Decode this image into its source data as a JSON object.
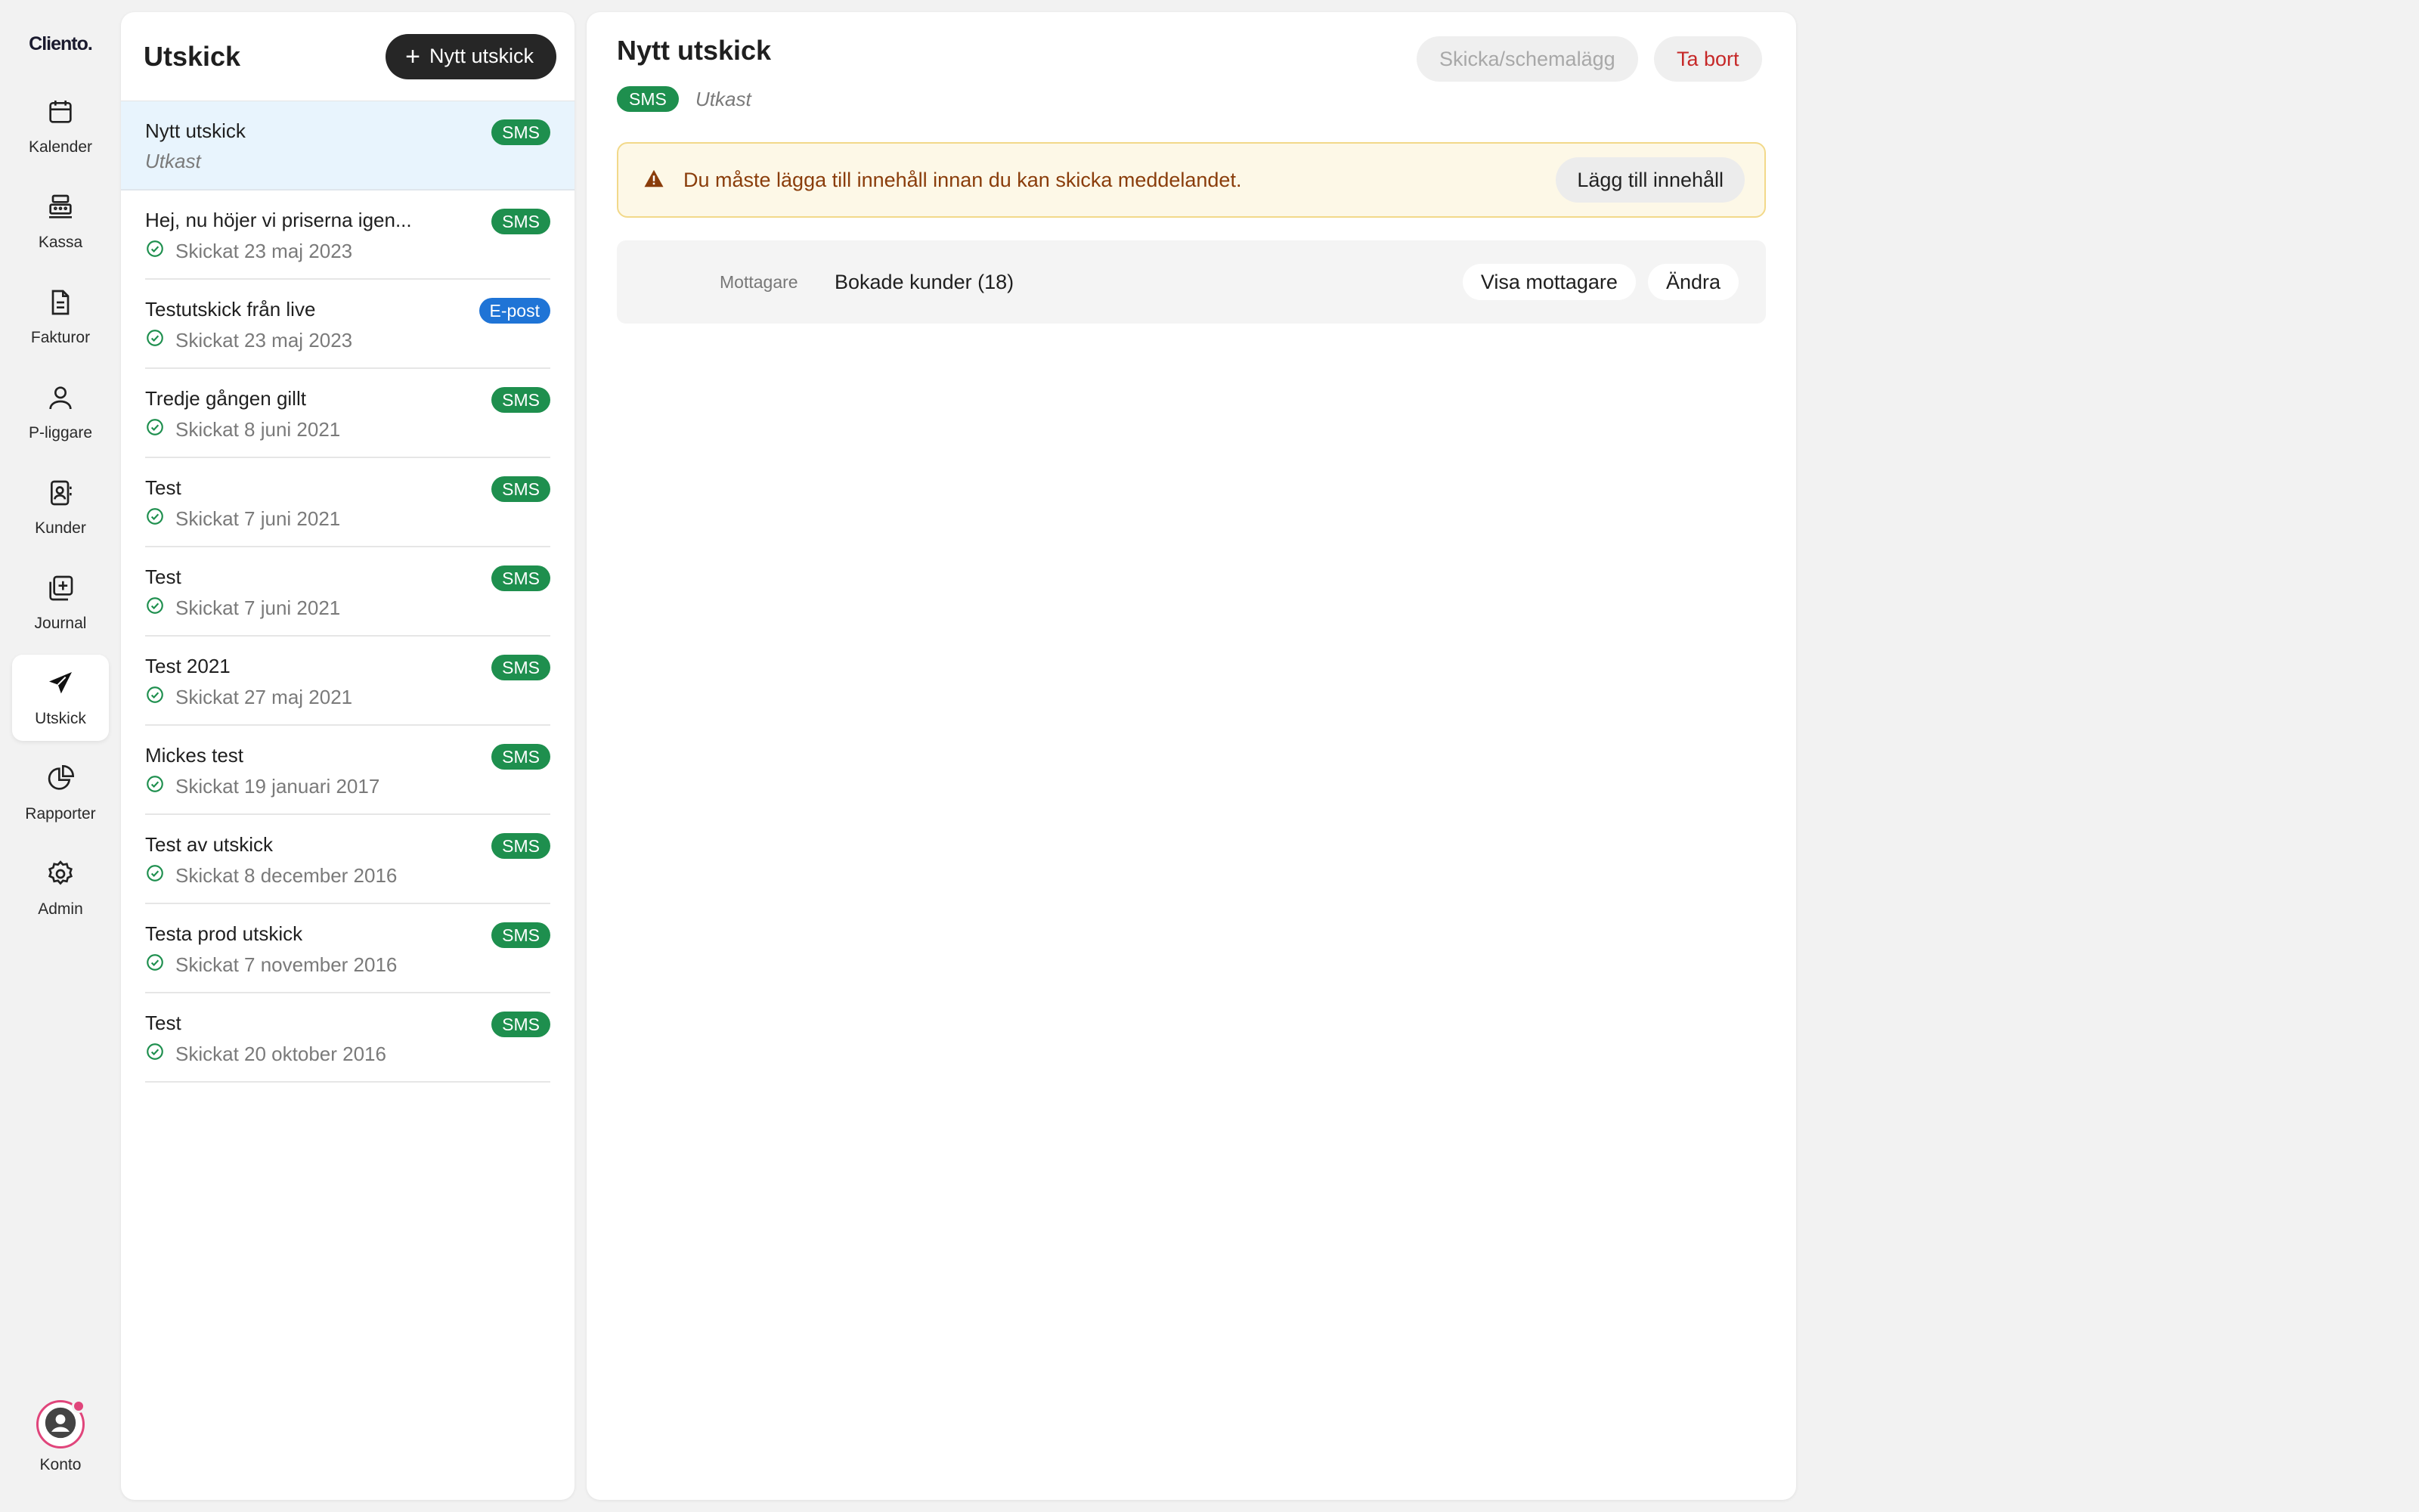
{
  "sidebar": {
    "logo": "Cliento.",
    "items": [
      {
        "label": "Kalender",
        "icon": "calendar-icon"
      },
      {
        "label": "Kassa",
        "icon": "cash-register-icon"
      },
      {
        "label": "Fakturor",
        "icon": "document-icon"
      },
      {
        "label": "P-liggare",
        "icon": "person-icon"
      },
      {
        "label": "Kunder",
        "icon": "contacts-icon"
      },
      {
        "label": "Journal",
        "icon": "journal-icon"
      },
      {
        "label": "Utskick",
        "icon": "send-icon",
        "active": true
      },
      {
        "label": "Rapporter",
        "icon": "pie-chart-icon"
      },
      {
        "label": "Admin",
        "icon": "gear-icon"
      }
    ],
    "account_label": "Konto"
  },
  "list": {
    "title": "Utskick",
    "new_button": "Nytt utskick",
    "rows": [
      {
        "title": "Nytt utskick",
        "sub": "Utkast",
        "badge": "SMS",
        "badge_type": "sms",
        "selected": true,
        "sent": false
      },
      {
        "title": "Hej, nu höjer vi priserna igen...",
        "sub": "Skickat 23 maj 2023",
        "badge": "SMS",
        "badge_type": "sms",
        "sent": true
      },
      {
        "title": "Testutskick från live",
        "sub": "Skickat 23 maj 2023",
        "badge": "E-post",
        "badge_type": "email",
        "sent": true
      },
      {
        "title": "Tredje gången gillt",
        "sub": "Skickat 8 juni 2021",
        "badge": "SMS",
        "badge_type": "sms",
        "sent": true
      },
      {
        "title": "Test",
        "sub": "Skickat 7 juni 2021",
        "badge": "SMS",
        "badge_type": "sms",
        "sent": true
      },
      {
        "title": "Test",
        "sub": "Skickat 7 juni 2021",
        "badge": "SMS",
        "badge_type": "sms",
        "sent": true
      },
      {
        "title": "Test 2021",
        "sub": "Skickat 27 maj 2021",
        "badge": "SMS",
        "badge_type": "sms",
        "sent": true
      },
      {
        "title": "Mickes test",
        "sub": "Skickat 19 januari 2017",
        "badge": "SMS",
        "badge_type": "sms",
        "sent": true
      },
      {
        "title": "Test av utskick",
        "sub": "Skickat 8 december 2016",
        "badge": "SMS",
        "badge_type": "sms",
        "sent": true
      },
      {
        "title": "Testa prod utskick",
        "sub": "Skickat 7 november 2016",
        "badge": "SMS",
        "badge_type": "sms",
        "sent": true
      },
      {
        "title": "Test",
        "sub": "Skickat 20 oktober 2016",
        "badge": "SMS",
        "badge_type": "sms",
        "sent": true
      }
    ]
  },
  "detail": {
    "title": "Nytt utskick",
    "badge": "SMS",
    "status": "Utkast",
    "send_button": "Skicka/schemalägg",
    "delete_button": "Ta bort",
    "alert": {
      "text": "Du måste lägga till innehåll innan du kan skicka meddelandet.",
      "button": "Lägg till innehåll"
    },
    "recipients": {
      "label": "Mottagare",
      "value": "Bokade kunder (18)",
      "show_button": "Visa mottagare",
      "edit_button": "Ändra"
    }
  },
  "colors": {
    "sms_badge": "#1e8f4e",
    "email_badge": "#1f74d6",
    "selected_row": "#e8f4fd",
    "alert_bg": "#fdf8e7",
    "alert_text": "#8a3d0b",
    "delete_text": "#c62828",
    "account_ring": "#e0457b"
  }
}
